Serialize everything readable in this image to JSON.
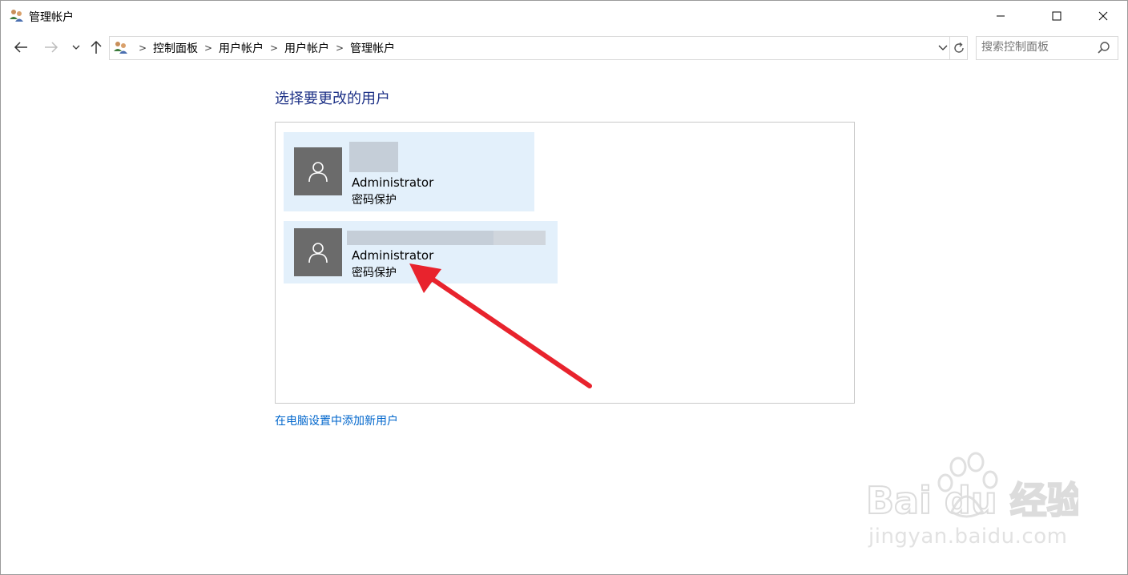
{
  "window": {
    "title": "管理帐户"
  },
  "navigation": {
    "breadcrumbs": [
      "控制面板",
      "用户帐户",
      "用户帐户",
      "管理帐户"
    ],
    "search_placeholder": "搜索控制面板"
  },
  "main": {
    "heading": "选择要更改的用户",
    "users": [
      {
        "account_type": "Administrator",
        "status": "密码保护"
      },
      {
        "account_type": "Administrator",
        "status": "密码保护"
      }
    ],
    "add_user_link": "在电脑设置中添加新用户"
  },
  "watermark": {
    "brand": "Bai du 经验",
    "url": "jingyan.baidu.com"
  },
  "colors": {
    "heading": "#1e3287",
    "link": "#0066cc",
    "tile_background": "#e3f0fb",
    "avatar": "#6b6b6b",
    "annotation_arrow": "#e8232d"
  }
}
